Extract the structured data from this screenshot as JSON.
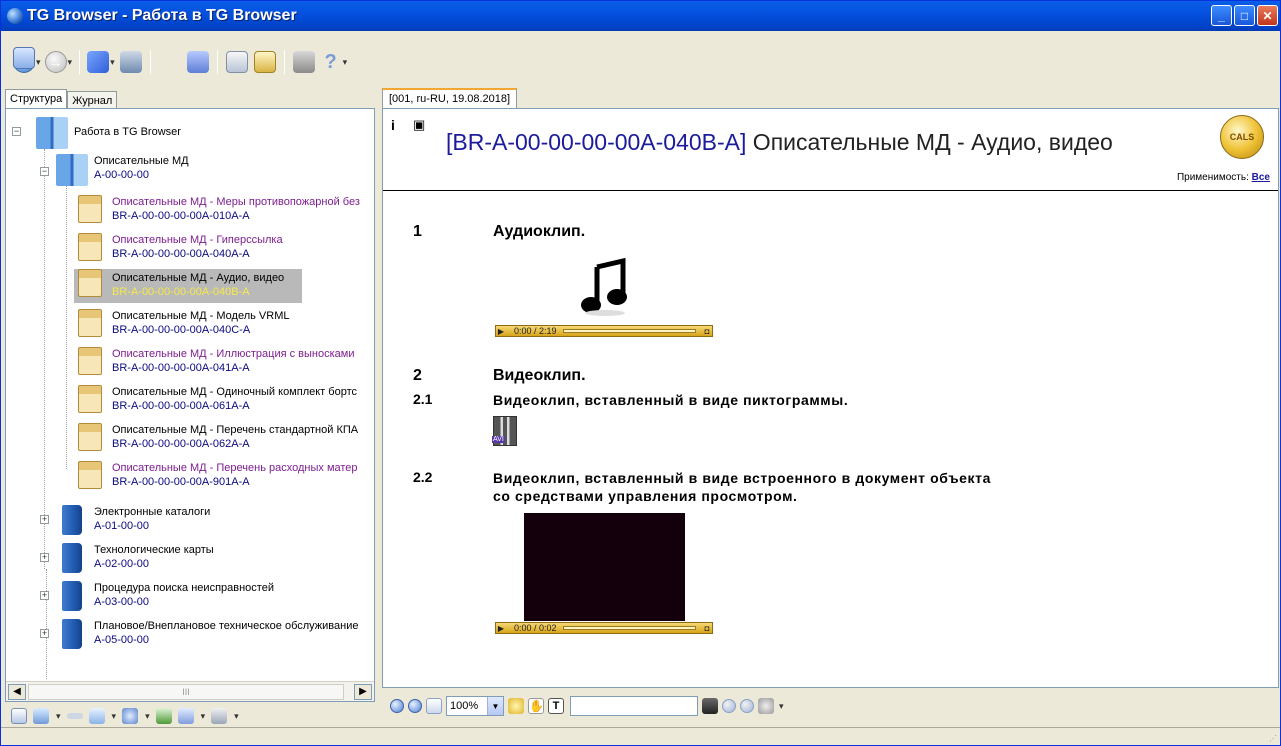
{
  "window": {
    "title": "TG Browser - Работа в TG Browser"
  },
  "left_tabs": [
    "Структура",
    "Журнал"
  ],
  "tree": {
    "root": {
      "label": "Работа в TG Browser"
    },
    "group": {
      "label": "Описательные МД",
      "code": "A-00-00-00"
    },
    "docs": [
      {
        "label": "Описательные МД - Меры противопожарной без",
        "code": "BR-A-00-00-00-00A-010A-A",
        "visited": true
      },
      {
        "label": "Описательные МД - Гиперссылка",
        "code": "BR-A-00-00-00-00A-040A-A",
        "visited": true
      },
      {
        "label": "Описательные МД - Аудио, видео",
        "code": "BR-A-00-00-00-00A-040B-A",
        "selected": true
      },
      {
        "label": "Описательные МД - Модель VRML",
        "code": "BR-A-00-00-00-00A-040C-A"
      },
      {
        "label": "Описательные МД - Иллюстрация с выносками",
        "code": "BR-A-00-00-00-00A-041A-A",
        "visited": true
      },
      {
        "label": "Описательные МД - Одиночный комплект бортс",
        "code": "BR-A-00-00-00-00A-061A-A"
      },
      {
        "label": "Описательные МД - Перечень стандартной КПА",
        "code": "BR-A-00-00-00-00A-062A-A"
      },
      {
        "label": "Описательные МД - Перечень расходных матер",
        "code": "BR-A-00-00-00-00A-901A-A",
        "visited": true
      }
    ],
    "books": [
      {
        "label": "Электронные каталоги",
        "code": "A-01-00-00"
      },
      {
        "label": "Технологические карты",
        "code": "A-02-00-00"
      },
      {
        "label": "Процедура поиска неисправностей",
        "code": "A-03-00-00"
      },
      {
        "label": "Плановое/Внеплановое техническое обслуживание",
        "code": "A-05-00-00"
      }
    ],
    "scroll_thumb": "III"
  },
  "doc_tab": "[001, ru-RU, 19.08.2018]",
  "document": {
    "code": "[BR-A-00-00-00-00A-040B-A]",
    "title": " Описательные МД - Аудио, видео",
    "logo_text": "CALS",
    "applicability_label": "Применимость:",
    "applicability_value": "Все",
    "sections": [
      {
        "num": "1",
        "title": "Аудиоклип."
      },
      {
        "num": "2",
        "title": "Видеоклип."
      }
    ],
    "subsections": [
      {
        "num": "2.1",
        "text": "Видеоклип, вставленный в виде пиктограммы."
      },
      {
        "num": "2.2",
        "line1": "Видеоклип, вставленный в виде встроенного в документ объекта",
        "line2": "со средствами управления просмотром."
      }
    ],
    "audio_time": "0:00 / 2:19",
    "video_time": "0:00 / 0:02",
    "avi_label": "AVI"
  },
  "view_toolbar": {
    "zoom": "100%"
  },
  "colors": {
    "title_bar": "#0551df",
    "accent_tab": "#f2a72e",
    "code_blue": "#1b1b9b",
    "visited_purple": "#7d1e8f"
  }
}
